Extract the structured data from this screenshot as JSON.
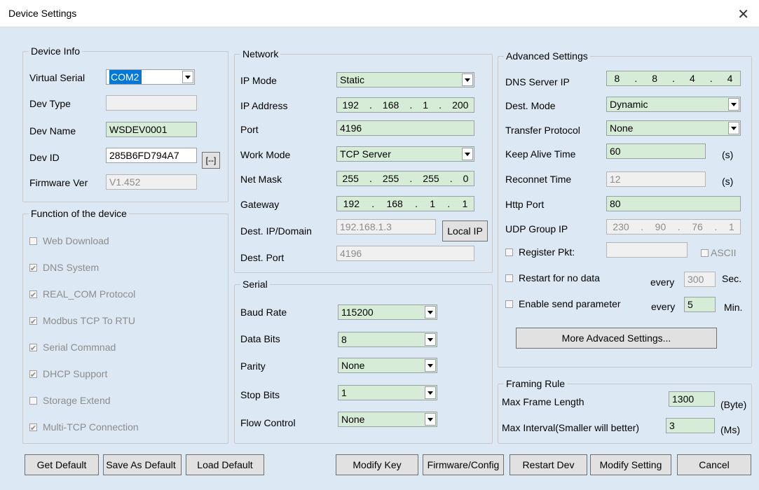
{
  "window": {
    "title": "Device Settings",
    "close_icon": "close-icon"
  },
  "device_info": {
    "title": "Device Info",
    "virtual_serial_label": "Virtual Serial",
    "virtual_serial_value": "COM2",
    "dev_type_label": "Dev Type",
    "dev_type_value": "",
    "dev_name_label": "Dev Name",
    "dev_name_value": "WSDEV0001",
    "dev_id_label": "Dev ID",
    "dev_id_value": "285B6FD794A7",
    "dev_id_button": "[--]",
    "firmware_label": "Firmware Ver",
    "firmware_value": "V1.452"
  },
  "functions": {
    "title": "Function of the device",
    "items": [
      {
        "label": "Web Download",
        "checked": false
      },
      {
        "label": "DNS System",
        "checked": true
      },
      {
        "label": "REAL_COM Protocol",
        "checked": true
      },
      {
        "label": "Modbus TCP To RTU",
        "checked": true
      },
      {
        "label": "Serial Commnad",
        "checked": true
      },
      {
        "label": "DHCP Support",
        "checked": true
      },
      {
        "label": "Storage Extend",
        "checked": false
      },
      {
        "label": "Multi-TCP Connection",
        "checked": true
      }
    ]
  },
  "network": {
    "title": "Network",
    "ip_mode_label": "IP Mode",
    "ip_mode_value": "Static",
    "ip_address_label": "IP Address",
    "ip_address": [
      "192",
      "168",
      "1",
      "200"
    ],
    "port_label": "Port",
    "port_value": "4196",
    "work_mode_label": "Work Mode",
    "work_mode_value": "TCP Server",
    "net_mask_label": "Net Mask",
    "net_mask": [
      "255",
      "255",
      "255",
      "0"
    ],
    "gateway_label": "Gateway",
    "gateway": [
      "192",
      "168",
      "1",
      "1"
    ],
    "dest_ip_label": "Dest. IP/Domain",
    "dest_ip_value": "192.168.1.3",
    "local_ip_button": "Local IP",
    "dest_port_label": "Dest. Port",
    "dest_port_value": "4196"
  },
  "serial": {
    "title": "Serial",
    "baud_label": "Baud Rate",
    "baud_value": "115200",
    "data_bits_label": "Data Bits",
    "data_bits_value": "8",
    "parity_label": "Parity",
    "parity_value": "None",
    "stop_bits_label": "Stop Bits",
    "stop_bits_value": "1",
    "flow_label": "Flow Control",
    "flow_value": "None"
  },
  "advanced": {
    "title": "Advanced Settings",
    "dns_label": "DNS Server IP",
    "dns_ip": [
      "8",
      "8",
      "4",
      "4"
    ],
    "dest_mode_label": "Dest. Mode",
    "dest_mode_value": "Dynamic",
    "transfer_label": "Transfer Protocol",
    "transfer_value": "None",
    "keep_alive_label": "Keep Alive Time",
    "keep_alive_value": "60",
    "keep_alive_unit": "(s)",
    "reconnect_label": "Reconnet Time",
    "reconnect_value": "12",
    "reconnect_unit": "(s)",
    "http_port_label": "Http Port",
    "http_port_value": "80",
    "udp_label": "UDP Group IP",
    "udp_ip": [
      "230",
      "90",
      "76",
      "1"
    ],
    "register_label": "Register Pkt:",
    "register_value": "",
    "ascii_label": "ASCII",
    "restart_label": "Restart for no data",
    "restart_every": "every",
    "restart_value": "300",
    "restart_unit": "Sec.",
    "enable_label": "Enable send parameter",
    "enable_every": "every",
    "enable_value": "5",
    "enable_unit": "Min.",
    "more_button": "More Advaced Settings..."
  },
  "framing": {
    "title": "Framing Rule",
    "max_len_label": "Max Frame Length",
    "max_len_value": "1300",
    "max_len_unit": "(Byte)",
    "max_int_label": "Max Interval(Smaller will better)",
    "max_int_value": "3",
    "max_int_unit": "(Ms)"
  },
  "buttons": {
    "get_default": "Get Default",
    "save_as_default": "Save As Default",
    "load_default": "Load Default",
    "modify_key": "Modify Key",
    "firmware_config": "Firmware/Config",
    "restart_dev": "Restart Dev",
    "modify_setting": "Modify Setting",
    "cancel": "Cancel"
  },
  "colors": {
    "background": "#dce9f4",
    "field_green": "#d6ecd6",
    "selection_blue": "#0078d7"
  }
}
